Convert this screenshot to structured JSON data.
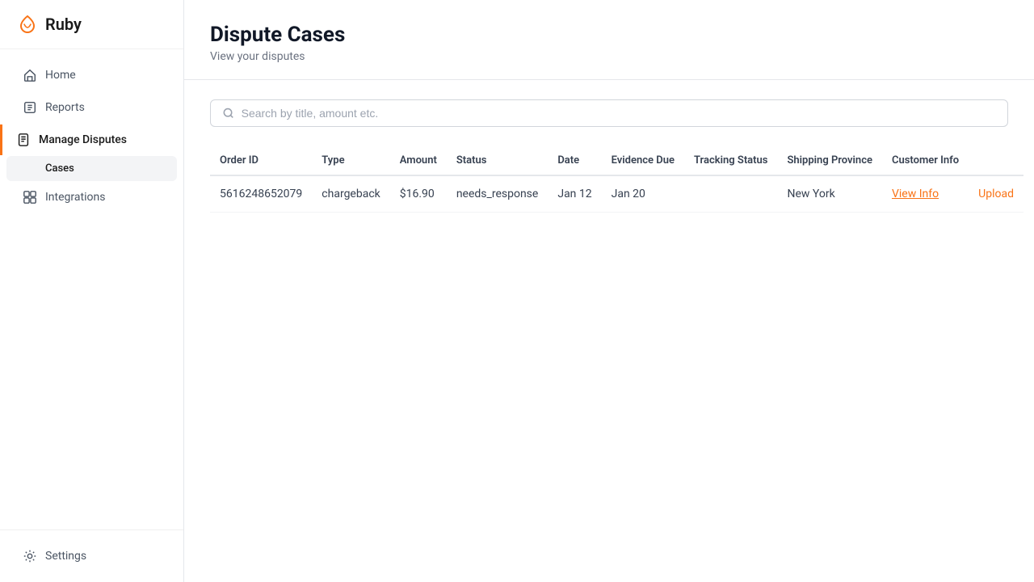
{
  "app": {
    "name": "Ruby"
  },
  "sidebar": {
    "nav_items": [
      {
        "id": "home",
        "label": "Home",
        "icon": "home-icon",
        "active": false
      },
      {
        "id": "reports",
        "label": "Reports",
        "icon": "reports-icon",
        "active": false
      },
      {
        "id": "manage-disputes",
        "label": "Manage Disputes",
        "icon": "disputes-icon",
        "active": true
      },
      {
        "id": "integrations",
        "label": "Integrations",
        "icon": "integrations-icon",
        "active": false
      }
    ],
    "sub_items": [
      {
        "id": "cases",
        "label": "Cases",
        "active": true
      }
    ],
    "bottom_items": [
      {
        "id": "settings",
        "label": "Settings",
        "icon": "settings-icon"
      }
    ]
  },
  "page": {
    "title": "Dispute Cases",
    "subtitle": "View your disputes"
  },
  "search": {
    "placeholder": "Search by title, amount etc."
  },
  "table": {
    "columns": [
      "Order ID",
      "Type",
      "Amount",
      "Status",
      "Date",
      "Evidence Due",
      "Tracking Status",
      "Shipping Province",
      "Customer Info",
      ""
    ],
    "rows": [
      {
        "order_id": "5616248652079",
        "type": "chargeback",
        "amount": "$16.90",
        "status": "needs_response",
        "date": "Jan 12",
        "evidence_due": "Jan 20",
        "tracking_status": "",
        "shipping_province": "New York",
        "customer_info_label": "View Info",
        "upload_label": "Upload"
      }
    ]
  }
}
